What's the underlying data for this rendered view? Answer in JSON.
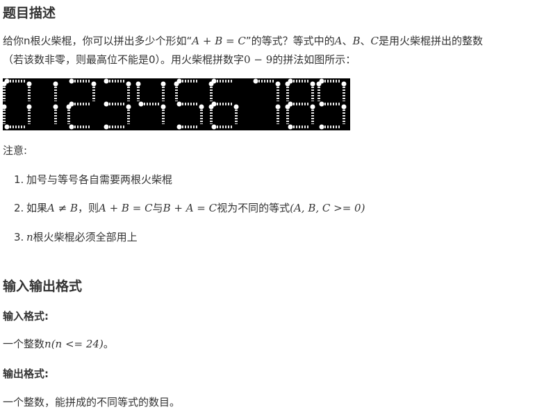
{
  "sections": {
    "description_title": "题目描述",
    "io_title": "输入输出格式",
    "input_title": "输入格式:",
    "output_title": "输出格式:"
  },
  "description": {
    "line1_a": "给你n根火柴棍，你可以拼出多少个形如“",
    "line1_math": "A + B = C",
    "line1_b": "”的等式？等式中的",
    "line1_A": "A",
    "sep1": "、",
    "line1_B": "B",
    "sep2": "、",
    "line1_C": "C",
    "line1_c": "是用火柴棍拼出的整数",
    "line2_a": "（若该数非零，则最高位不能是0）。用火柴棍拼数字",
    "line2_math": "0 − 9",
    "line2_b": "的拼法如图所示："
  },
  "notes": {
    "title": "注意:",
    "item1_num": "1.",
    "item1": "加号与等号各自需要两根火柴棍",
    "item2_num": "2.",
    "item2_a": "如果",
    "item2_m1": "A ≠ B",
    "item2_b": "，则",
    "item2_m2": "A + B = C",
    "item2_c": "与",
    "item2_m3": "B + A = C",
    "item2_d": "视为不同的等式",
    "item2_m4": "(A, B, C >= 0)",
    "item3_num": "3.",
    "item3_m": "n",
    "item3": "根火柴棍必须全部用上"
  },
  "input": {
    "text_a": "一个整数",
    "math_n": "n",
    "math_cond": "(n <= 24)",
    "text_b": "。"
  },
  "output": {
    "text": "一个整数，能拼成的不同等式的数目。"
  },
  "digits": [
    "0",
    "1",
    "2",
    "3",
    "4",
    "5",
    "6",
    "7",
    "8",
    "9"
  ]
}
